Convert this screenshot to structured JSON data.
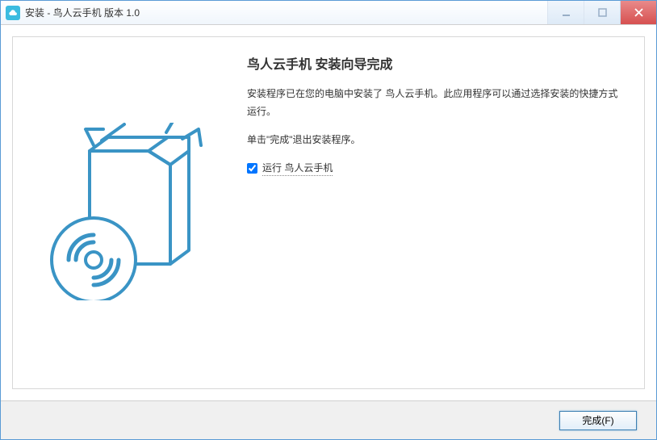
{
  "window": {
    "title": "安装 - 鸟人云手机 版本 1.0"
  },
  "wizard": {
    "heading": "鸟人云手机 安装向导完成",
    "paragraph1": "安装程序已在您的电脑中安装了 鸟人云手机。此应用程序可以通过选择安装的快捷方式运行。",
    "paragraph2": "单击\"完成\"退出安装程序。",
    "checkbox_label": "运行 鸟人云手机"
  },
  "footer": {
    "finish_label": "完成(F)"
  }
}
